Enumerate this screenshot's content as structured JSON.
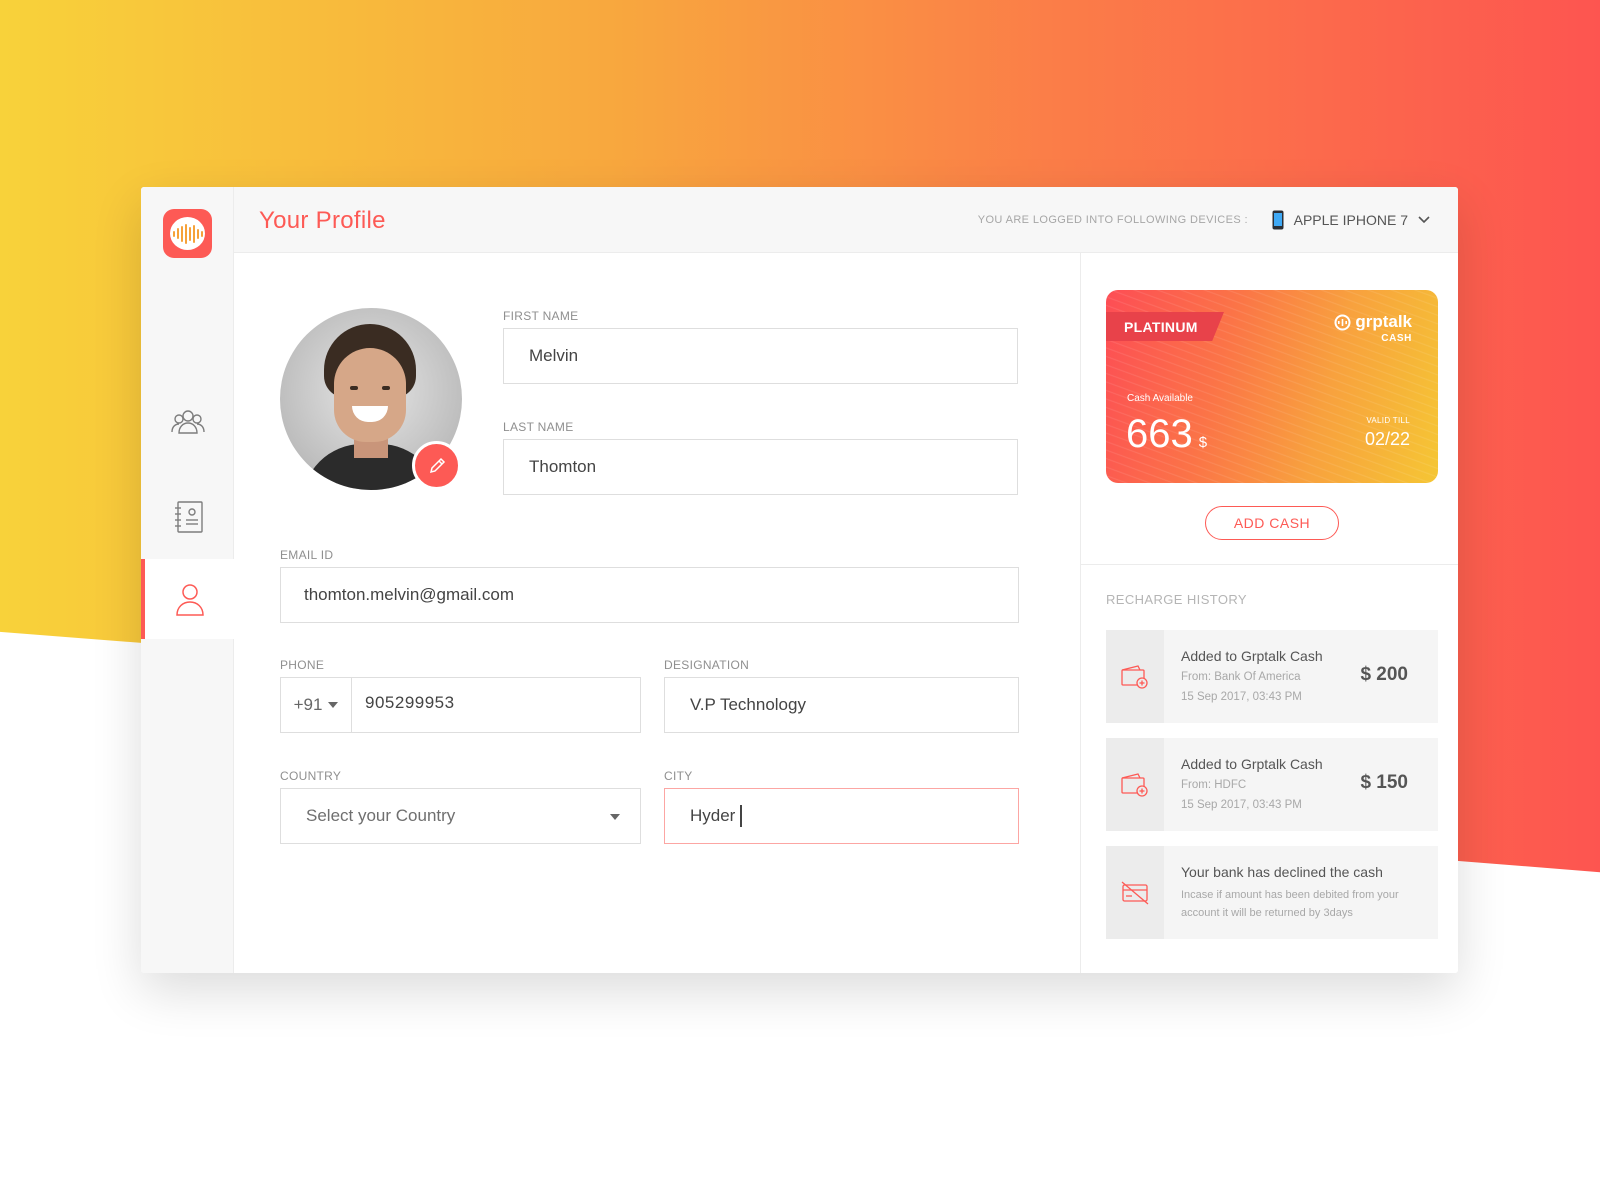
{
  "header": {
    "title": "Your Profile",
    "devices_label": "YOU ARE LOGGED INTO FOLLOWING DEVICES :",
    "device": "APPLE IPHONE 7"
  },
  "sidebar": {
    "items": [
      {
        "icon": "group-icon",
        "active": false
      },
      {
        "icon": "contacts-book-icon",
        "active": false
      },
      {
        "icon": "user-icon",
        "active": true
      }
    ]
  },
  "form": {
    "first_name": {
      "label": "FIRST NAME",
      "value": "Melvin"
    },
    "last_name": {
      "label": "LAST NAME",
      "value": "Thomton"
    },
    "email": {
      "label": "EMAIL ID",
      "value": "thomton.melvin@gmail.com"
    },
    "phone": {
      "label": "PHONE",
      "code": "+91",
      "value": "905299953"
    },
    "designation": {
      "label": "DESIGNATION",
      "value": "V.P Technology"
    },
    "country": {
      "label": "COUNTRY",
      "placeholder": "Select your Country"
    },
    "city": {
      "label": "CITY",
      "value": "Hyder"
    }
  },
  "card": {
    "tier": "PLATINUM",
    "brand": "grptalk",
    "brand_sub": "CASH",
    "cash_label": "Cash Available",
    "amount": "663",
    "currency": "$",
    "valid_label": "VALID TILL",
    "valid_value": "02/22",
    "add_cash": "ADD CASH"
  },
  "history": {
    "title": "RECHARGE HISTORY",
    "items": [
      {
        "title": "Added to Grptalk Cash",
        "from": "From: Bank Of America",
        "date": "15 Sep 2017, 03:43 PM",
        "amount": "$ 200",
        "icon": "wallet-add-icon"
      },
      {
        "title": "Added to Grptalk Cash",
        "from": "From: HDFC",
        "date": "15 Sep 2017, 03:43 PM",
        "amount": "$ 150",
        "icon": "wallet-add-icon"
      },
      {
        "title": "Your bank has declined the cash",
        "note": "Incase if amount has been debited from your account it will be returned by 3days",
        "icon": "card-declined-icon"
      }
    ]
  },
  "colors": {
    "accent": "#fd5a55",
    "gradient_start": "#f8d23a",
    "gradient_end": "#fd5550"
  }
}
